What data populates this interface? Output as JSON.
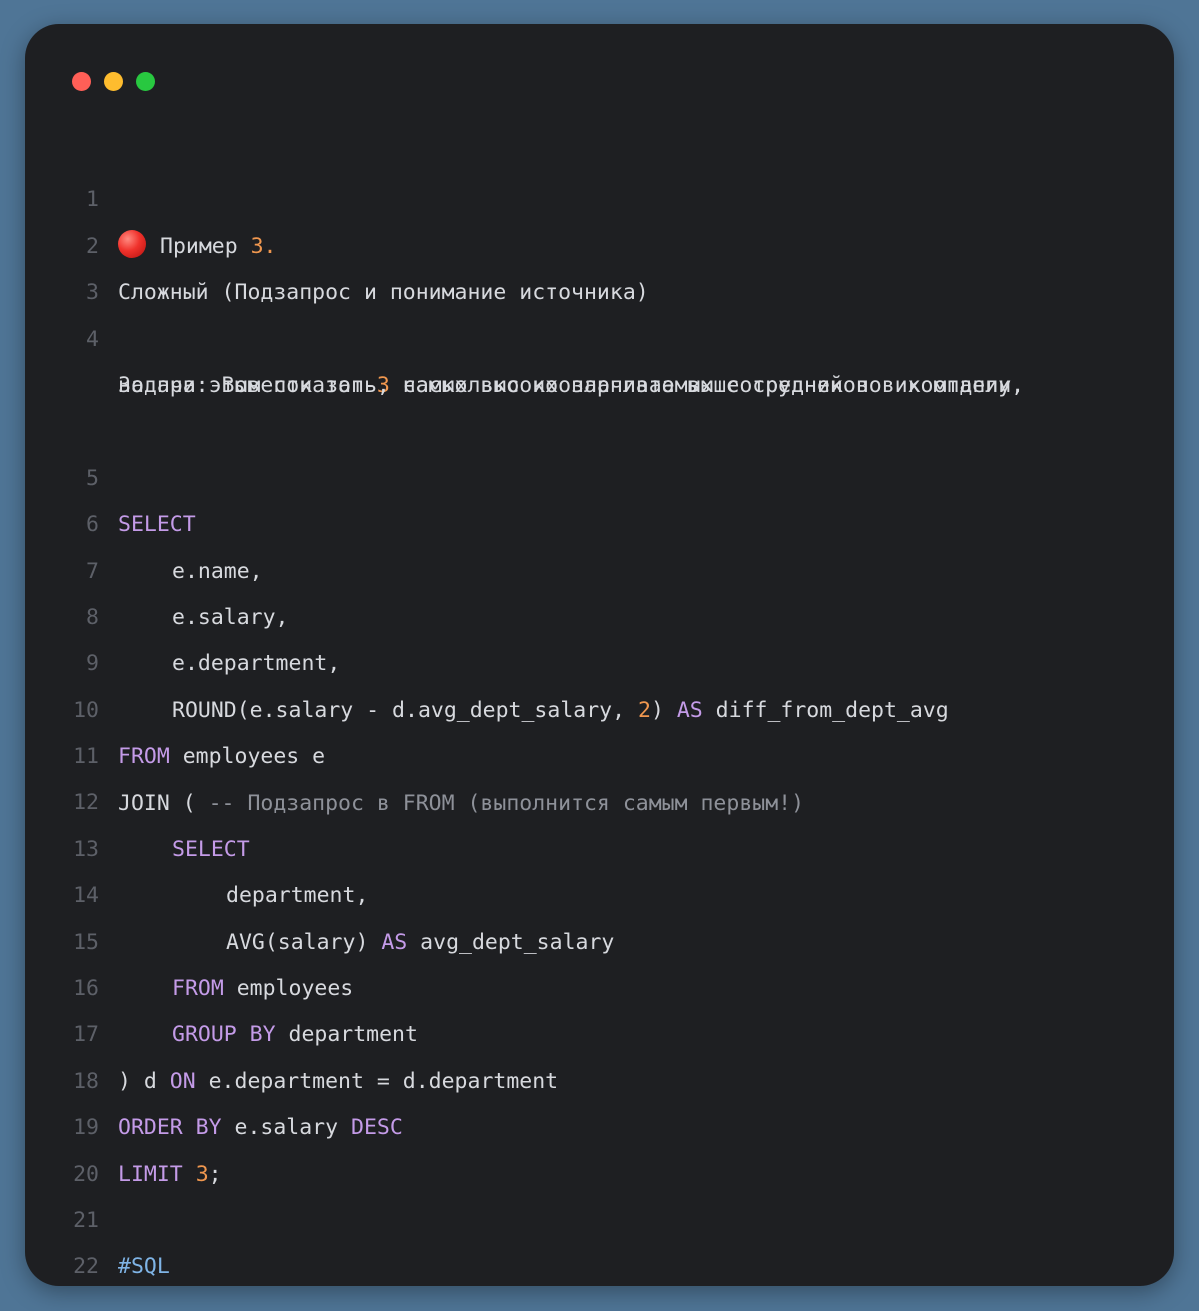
{
  "window": {
    "traffic_colors": [
      "#ff5f57",
      "#febc2e",
      "#28c840"
    ]
  },
  "code": {
    "line1": {
      "num": "1",
      "text": "Пример ",
      "num_val": "3."
    },
    "line2": {
      "num": "2",
      "text": "Сложный (Подзапрос и понимание источника)"
    },
    "line3": {
      "num": "3"
    },
    "line4": {
      "num": "4",
      "a": "Задача: Вывести топ-",
      "n": "3",
      "b": " самых высокооплачиваемых сотрудников в компании,",
      "cont": "но при этом показать, насколько их зарплата выше средней по их отделу."
    },
    "line5": {
      "num": "5",
      "kw": "SELECT"
    },
    "line6": {
      "num": "6",
      "text": "e.name,"
    },
    "line7": {
      "num": "7",
      "text": "e.salary,"
    },
    "line8": {
      "num": "8",
      "text": "e.department,"
    },
    "line9": {
      "num": "9",
      "a": "ROUND(e.salary - d.avg_dept_salary, ",
      "n": "2",
      "b": ") ",
      "kw": "AS",
      "c": " diff_from_dept_avg"
    },
    "line10": {
      "num": "10",
      "kw": "FROM",
      "text": " employees e"
    },
    "line11": {
      "num": "11",
      "a": "JOIN ( ",
      "comment": "-- Подзапрос в FROM (выполнится самым первым!)"
    },
    "line12": {
      "num": "12",
      "kw": "SELECT"
    },
    "line13": {
      "num": "13",
      "text": "department,"
    },
    "line14": {
      "num": "14",
      "a": "AVG(salary) ",
      "kw": "AS",
      "b": " avg_dept_salary"
    },
    "line15": {
      "num": "15",
      "kw": "FROM",
      "text": " employees"
    },
    "line16": {
      "num": "16",
      "kw": "GROUP BY",
      "text": " department"
    },
    "line17": {
      "num": "17",
      "a": ") d ",
      "kw": "ON",
      "b": " e.department = d.department"
    },
    "line18": {
      "num": "18",
      "kw": "ORDER BY",
      "a": " e.salary ",
      "kw2": "DESC"
    },
    "line19": {
      "num": "19",
      "kw": "LIMIT",
      "a": " ",
      "n": "3",
      "b": ";"
    },
    "line20": {
      "num": "20"
    },
    "line21": {
      "num": "21",
      "tag": "#SQL"
    },
    "line22": {
      "num": "22"
    }
  }
}
